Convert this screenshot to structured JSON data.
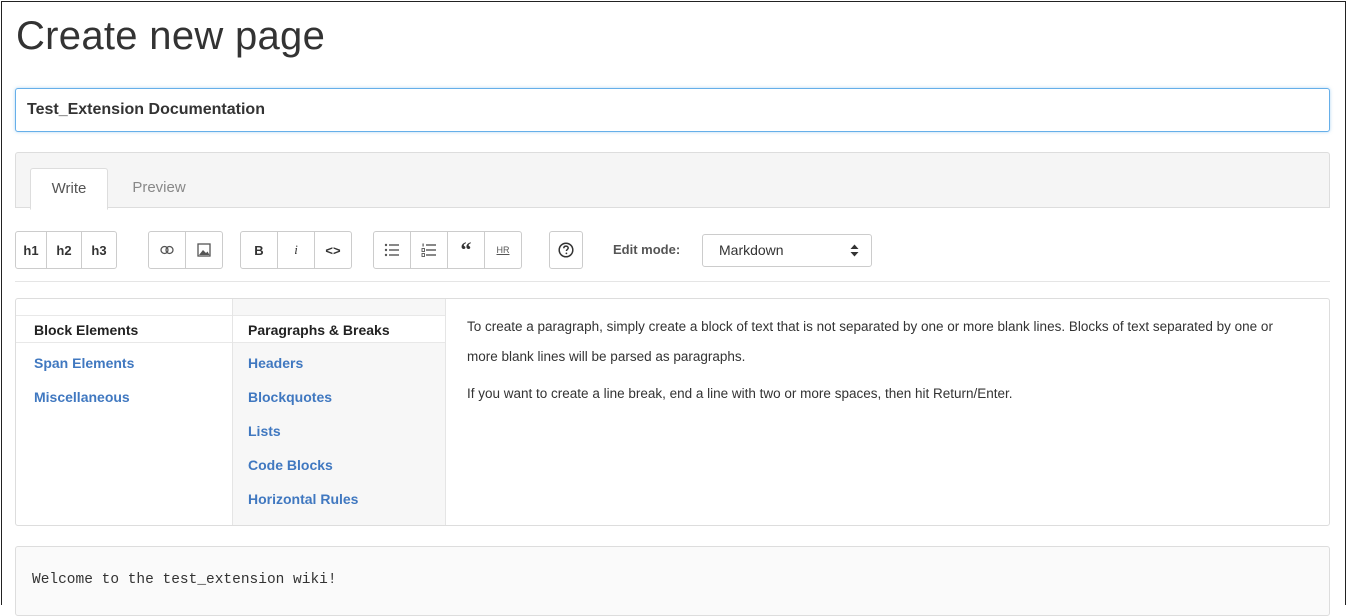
{
  "page": {
    "title": "Create new page"
  },
  "title_field": {
    "value": "Test_Extension Documentation"
  },
  "tabs": [
    {
      "label": "Write",
      "active": true
    },
    {
      "label": "Preview",
      "active": false
    }
  ],
  "toolbar": {
    "h1": "h1",
    "h2": "h2",
    "h3": "h3",
    "link_icon": "link-icon",
    "image_icon": "image-icon",
    "bold": "B",
    "italic": "i",
    "code": "<>",
    "ul_icon": "unordered-list-icon",
    "ol_icon": "ordered-list-icon",
    "quote": "“",
    "hr": "HR",
    "help_icon": "help-icon",
    "edit_mode_label": "Edit mode:",
    "edit_mode_value": "Markdown"
  },
  "help": {
    "categories": [
      {
        "label": "Block Elements",
        "active": true
      },
      {
        "label": "Span Elements",
        "active": false
      },
      {
        "label": "Miscellaneous",
        "active": false
      }
    ],
    "topics": [
      {
        "label": "Paragraphs & Breaks",
        "active": true
      },
      {
        "label": "Headers",
        "active": false
      },
      {
        "label": "Blockquotes",
        "active": false
      },
      {
        "label": "Lists",
        "active": false
      },
      {
        "label": "Code Blocks",
        "active": false
      },
      {
        "label": "Horizontal Rules",
        "active": false
      }
    ],
    "text": [
      "To create a paragraph, simply create a block of text that is not separated by one or more blank lines. Blocks of text separated by one or more blank lines will be parsed as paragraphs.",
      "If you want to create a line break, end a line with two or more spaces, then hit Return/Enter."
    ]
  },
  "editor": {
    "content": "Welcome to the test_extension wiki!"
  },
  "colors": {
    "link": "#4078c0",
    "focus_border": "#66afe9"
  }
}
